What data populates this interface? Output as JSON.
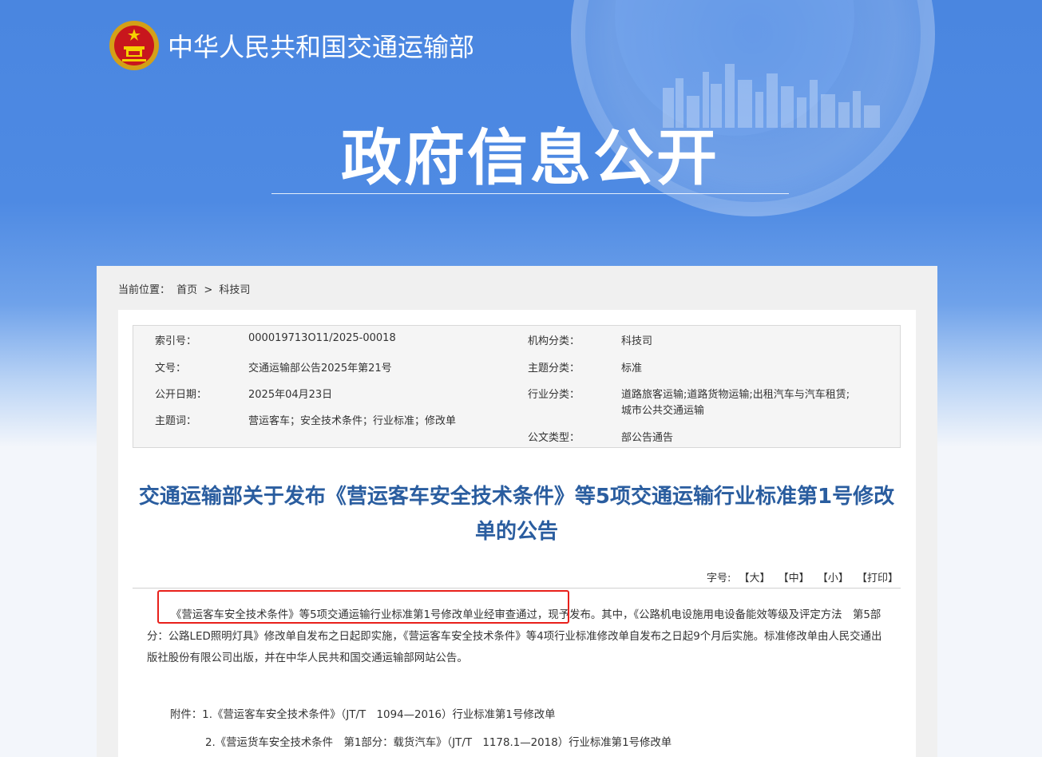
{
  "header": {
    "ministry_name": "中华人民共和国交通运输部",
    "section_title": "政府信息公开"
  },
  "breadcrumb": {
    "label": "当前位置：",
    "home": "首页",
    "separator": ">",
    "current": "科技司"
  },
  "meta": {
    "index_no_label": "索引号：",
    "index_no": "000019713O11/2025-00018",
    "doc_no_label": "文号：",
    "doc_no": "交通运输部公告2025年第21号",
    "date_label": "公开日期：",
    "date": "2025年04月23日",
    "keywords_label": "主题词：",
    "keywords": "营运客车；安全技术条件；行业标准；修改单",
    "org_label": "机构分类：",
    "org": "科技司",
    "topic_label": "主题分类：",
    "topic": "标准",
    "industry_label": "行业分类：",
    "industry_line1": "道路旅客运输;道路货物运输;出租汽车与汽车租赁;",
    "industry_line2": "城市公共交通运输",
    "doctype_label": "公文类型：",
    "doctype": "部公告通告"
  },
  "article": {
    "title": "交通运输部关于发布《营运客车安全技术条件》等5项交通运输行业标准第1号修改单的公告",
    "font_size_label": "字号:",
    "font_large": "【大】",
    "font_medium": "【中】",
    "font_small": "【小】",
    "print": "【打印】",
    "body": "《营运客车安全技术条件》等5项交通运输行业标准第1号修改单业经审查通过，现予发布。其中，《公路机电设施用电设备能效等级及评定方法　第5部分：公路LED照明灯具》修改单自发布之日起即实施，《营运客车安全技术条件》等4项行业标准修改单自发布之日起9个月后实施。标准修改单由人民交通出版社股份有限公司出版，并在中华人民共和国交通运输部网站公告。",
    "attachment_1": "附件：1.《营运客车安全技术条件》（JT/T　1094—2016）行业标准第1号修改单",
    "attachment_2": "2.《营运货车安全技术条件　第1部分：载货汽车》（JT/T　1178.1—2018）行业标准第1号修改单"
  },
  "colors": {
    "hero_blue": "#4a86e0",
    "title_blue": "#2a5d9f",
    "highlight_red": "#e8201b"
  }
}
